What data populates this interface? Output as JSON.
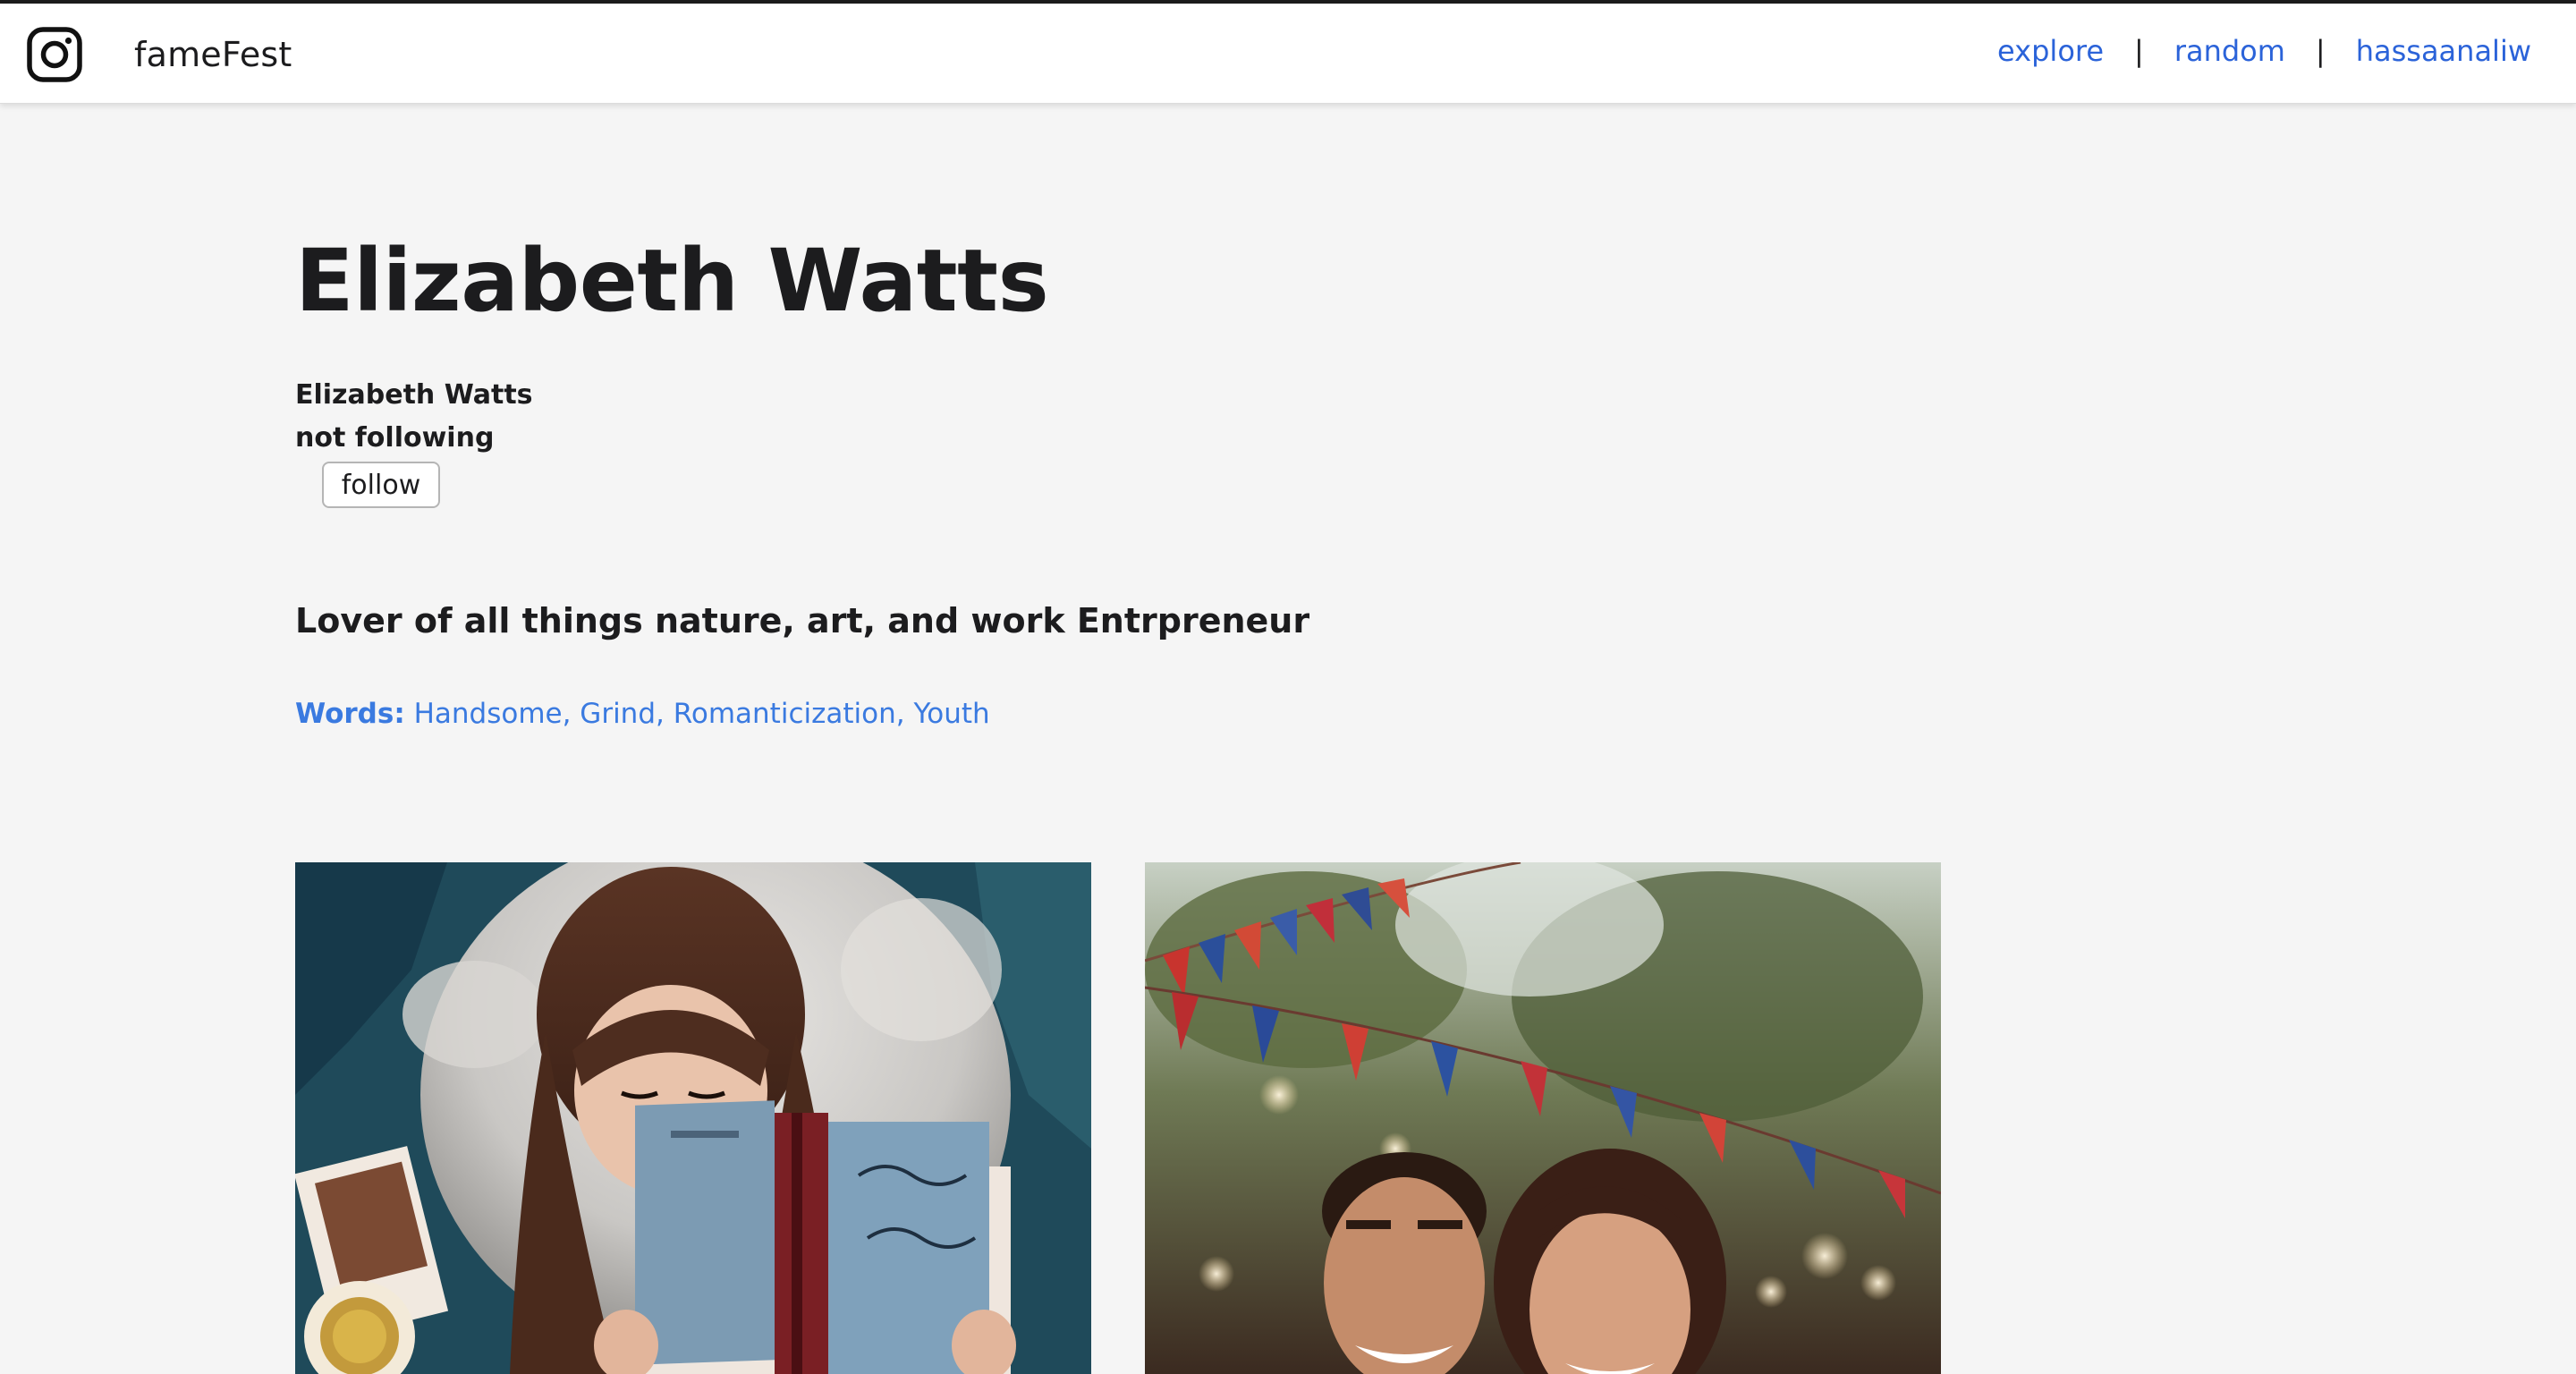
{
  "app": {
    "name": "fameFest",
    "logo_icon": "camera-logo-icon"
  },
  "nav": {
    "items": [
      "explore",
      "random",
      "hassaanaliw"
    ],
    "separator": "|",
    "link_color": "#2b63d9"
  },
  "profile": {
    "title": "Elizabeth Watts",
    "name": "Elizabeth Watts",
    "follow_status": "not following",
    "follow_button": "follow",
    "bio": "Lover of all things nature, art, and work Entrpreneur",
    "words_label": "Words:",
    "words": "Handsome, Grind, Romanticization, Youth",
    "words_color": "#3a7ae0"
  },
  "gallery": {
    "photos": [
      {
        "subject": "woman-reading-book-photo"
      },
      {
        "subject": "couple-at-festival-photo"
      }
    ]
  }
}
